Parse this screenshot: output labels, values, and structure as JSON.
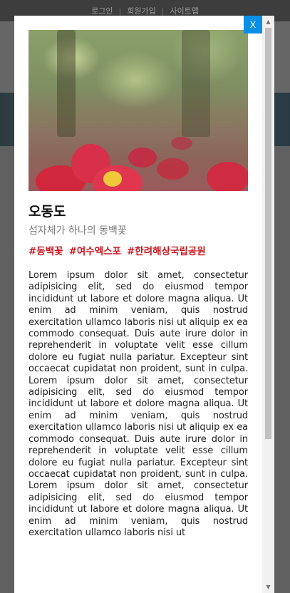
{
  "background": {
    "topbar": {
      "links": [
        "로그인",
        "회원가입",
        "사이트맵"
      ]
    }
  },
  "modal": {
    "close_label": "X",
    "title": "오동도",
    "subtitle": "섬자체가 하나의 동백꽃",
    "tags": [
      "#동백꽃",
      "#여수엑스포",
      "#한려해상국립공원"
    ],
    "body": "Lorem ipsum dolor sit amet, consectetur adipisicing elit, sed do eiusmod tempor incididunt ut labore et dolore magna aliqua. Ut enim ad minim veniam, quis nostrud exercitation ullamco laboris nisi ut aliquip ex ea commodo consequat. Duis aute irure dolor in reprehenderit in voluptate velit esse cillum dolore eu fugiat nulla pariatur. Excepteur sint occaecat cupidatat non proident, sunt in culpa. Lorem ipsum dolor sit amet, consectetur adipisicing elit, sed do eiusmod tempor incididunt ut labore et dolore magna aliqua. Ut enim ad minim veniam, quis nostrud exercitation ullamco laboris nisi ut aliquip ex ea commodo consequat. Duis aute irure dolor in reprehenderit in voluptate velit esse cillum dolore eu fugiat nulla pariatur. Excepteur sint occaecat cupidatat non proident, sunt in culpa. Lorem ipsum dolor sit amet, consectetur adipisicing elit, sed do eiusmod tempor incididunt ut labore et dolore magna aliqua. Ut enim ad minim veniam, quis nostrud exercitation ullamco laboris nisi ut"
  },
  "colors": {
    "tag": "#c9181f",
    "close_button": "#0a8fe6",
    "overlay": "#5a5a5a"
  },
  "icons": {
    "scroll_up": "triangle-up",
    "scroll_down": "triangle-down"
  }
}
